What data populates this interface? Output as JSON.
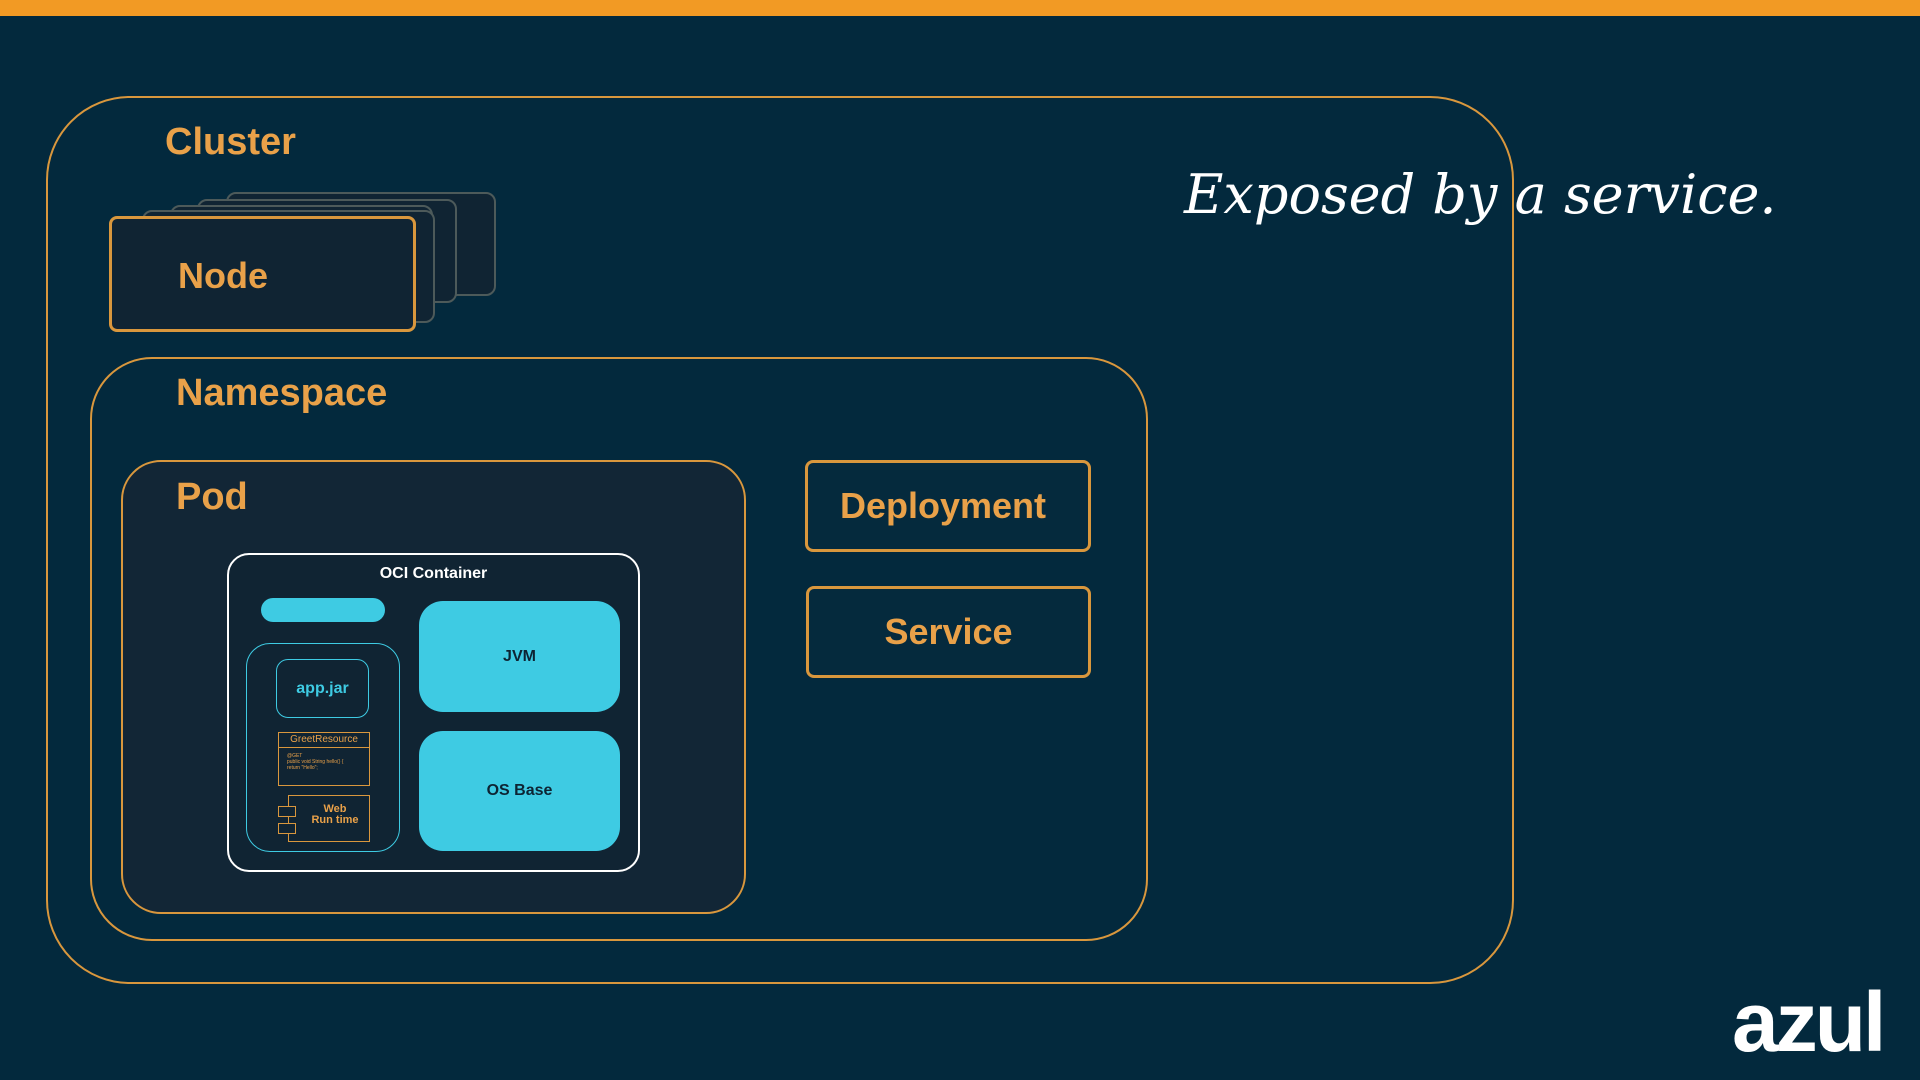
{
  "colors": {
    "background": "#03293d",
    "accent_bar": "#f29a24",
    "orange": "#d9973d",
    "orange_text": "#e9a149",
    "cyan": "#3ecbe3",
    "white": "#ffffff"
  },
  "cluster": {
    "label": "Cluster"
  },
  "node": {
    "label": "Node"
  },
  "namespace": {
    "label": "Namespace"
  },
  "pod": {
    "label": "Pod"
  },
  "deployment": {
    "label": "Deployment"
  },
  "service": {
    "label": "Service"
  },
  "oci_container": {
    "label": "OCI Container",
    "jvm_label": "JVM",
    "os_base_label": "OS Base",
    "app_jar_label": "app.jar",
    "greet_resource": {
      "title": "GreetResource",
      "line1": "@GET",
      "line2": "public void String   hello() {",
      "line3": "   return \"Hello\";"
    },
    "web_runtime_label_1": "Web",
    "web_runtime_label_2": "Run time"
  },
  "caption": "Exposed by a service.",
  "logo_text": "azul"
}
